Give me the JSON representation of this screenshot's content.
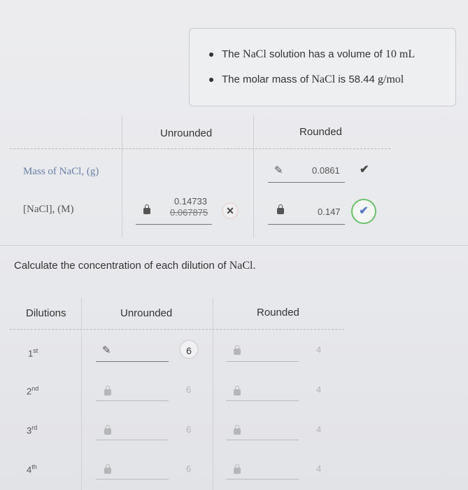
{
  "info": {
    "bullets": [
      {
        "pre": "The ",
        "formula": "NaCl",
        "mid": " solution has a volume of ",
        "value": "10",
        "unit": " mL"
      },
      {
        "pre": "The molar mass of ",
        "formula": "NaCl",
        "mid": " is ",
        "value": "58.44",
        "unit": " g/mol"
      }
    ]
  },
  "table1": {
    "col_unrounded": "Unrounded",
    "col_rounded": "Rounded",
    "rows": [
      {
        "label": "Mass of NaCl, (g)",
        "rounded_value": "0.0861"
      },
      {
        "label": "[NaCl], (M)",
        "unrounded_correct": "0.14733",
        "unrounded_value": "0.067875",
        "rounded_value": "0.147"
      }
    ],
    "icons": {
      "pencil": "pencil-icon",
      "lock": "lock-icon",
      "check": "checkmark-icon",
      "x": "x-mark-icon"
    }
  },
  "instruction": {
    "text": "Calculate the concentration of each dilution of ",
    "formula": "NaCl."
  },
  "table2": {
    "col_dilutions": "Dilutions",
    "col_unrounded": "Unrounded",
    "col_rounded": "Rounded",
    "rows": [
      {
        "num": "1",
        "suffix": "st",
        "sigfig_unrounded": "6",
        "sigfig_rounded": "4"
      },
      {
        "num": "2",
        "suffix": "nd",
        "sigfig_unrounded": "6",
        "sigfig_rounded": "4"
      },
      {
        "num": "3",
        "suffix": "rd",
        "sigfig_unrounded": "6",
        "sigfig_rounded": "4"
      },
      {
        "num": "4",
        "suffix": "th",
        "sigfig_unrounded": "6",
        "sigfig_rounded": "4"
      }
    ]
  }
}
